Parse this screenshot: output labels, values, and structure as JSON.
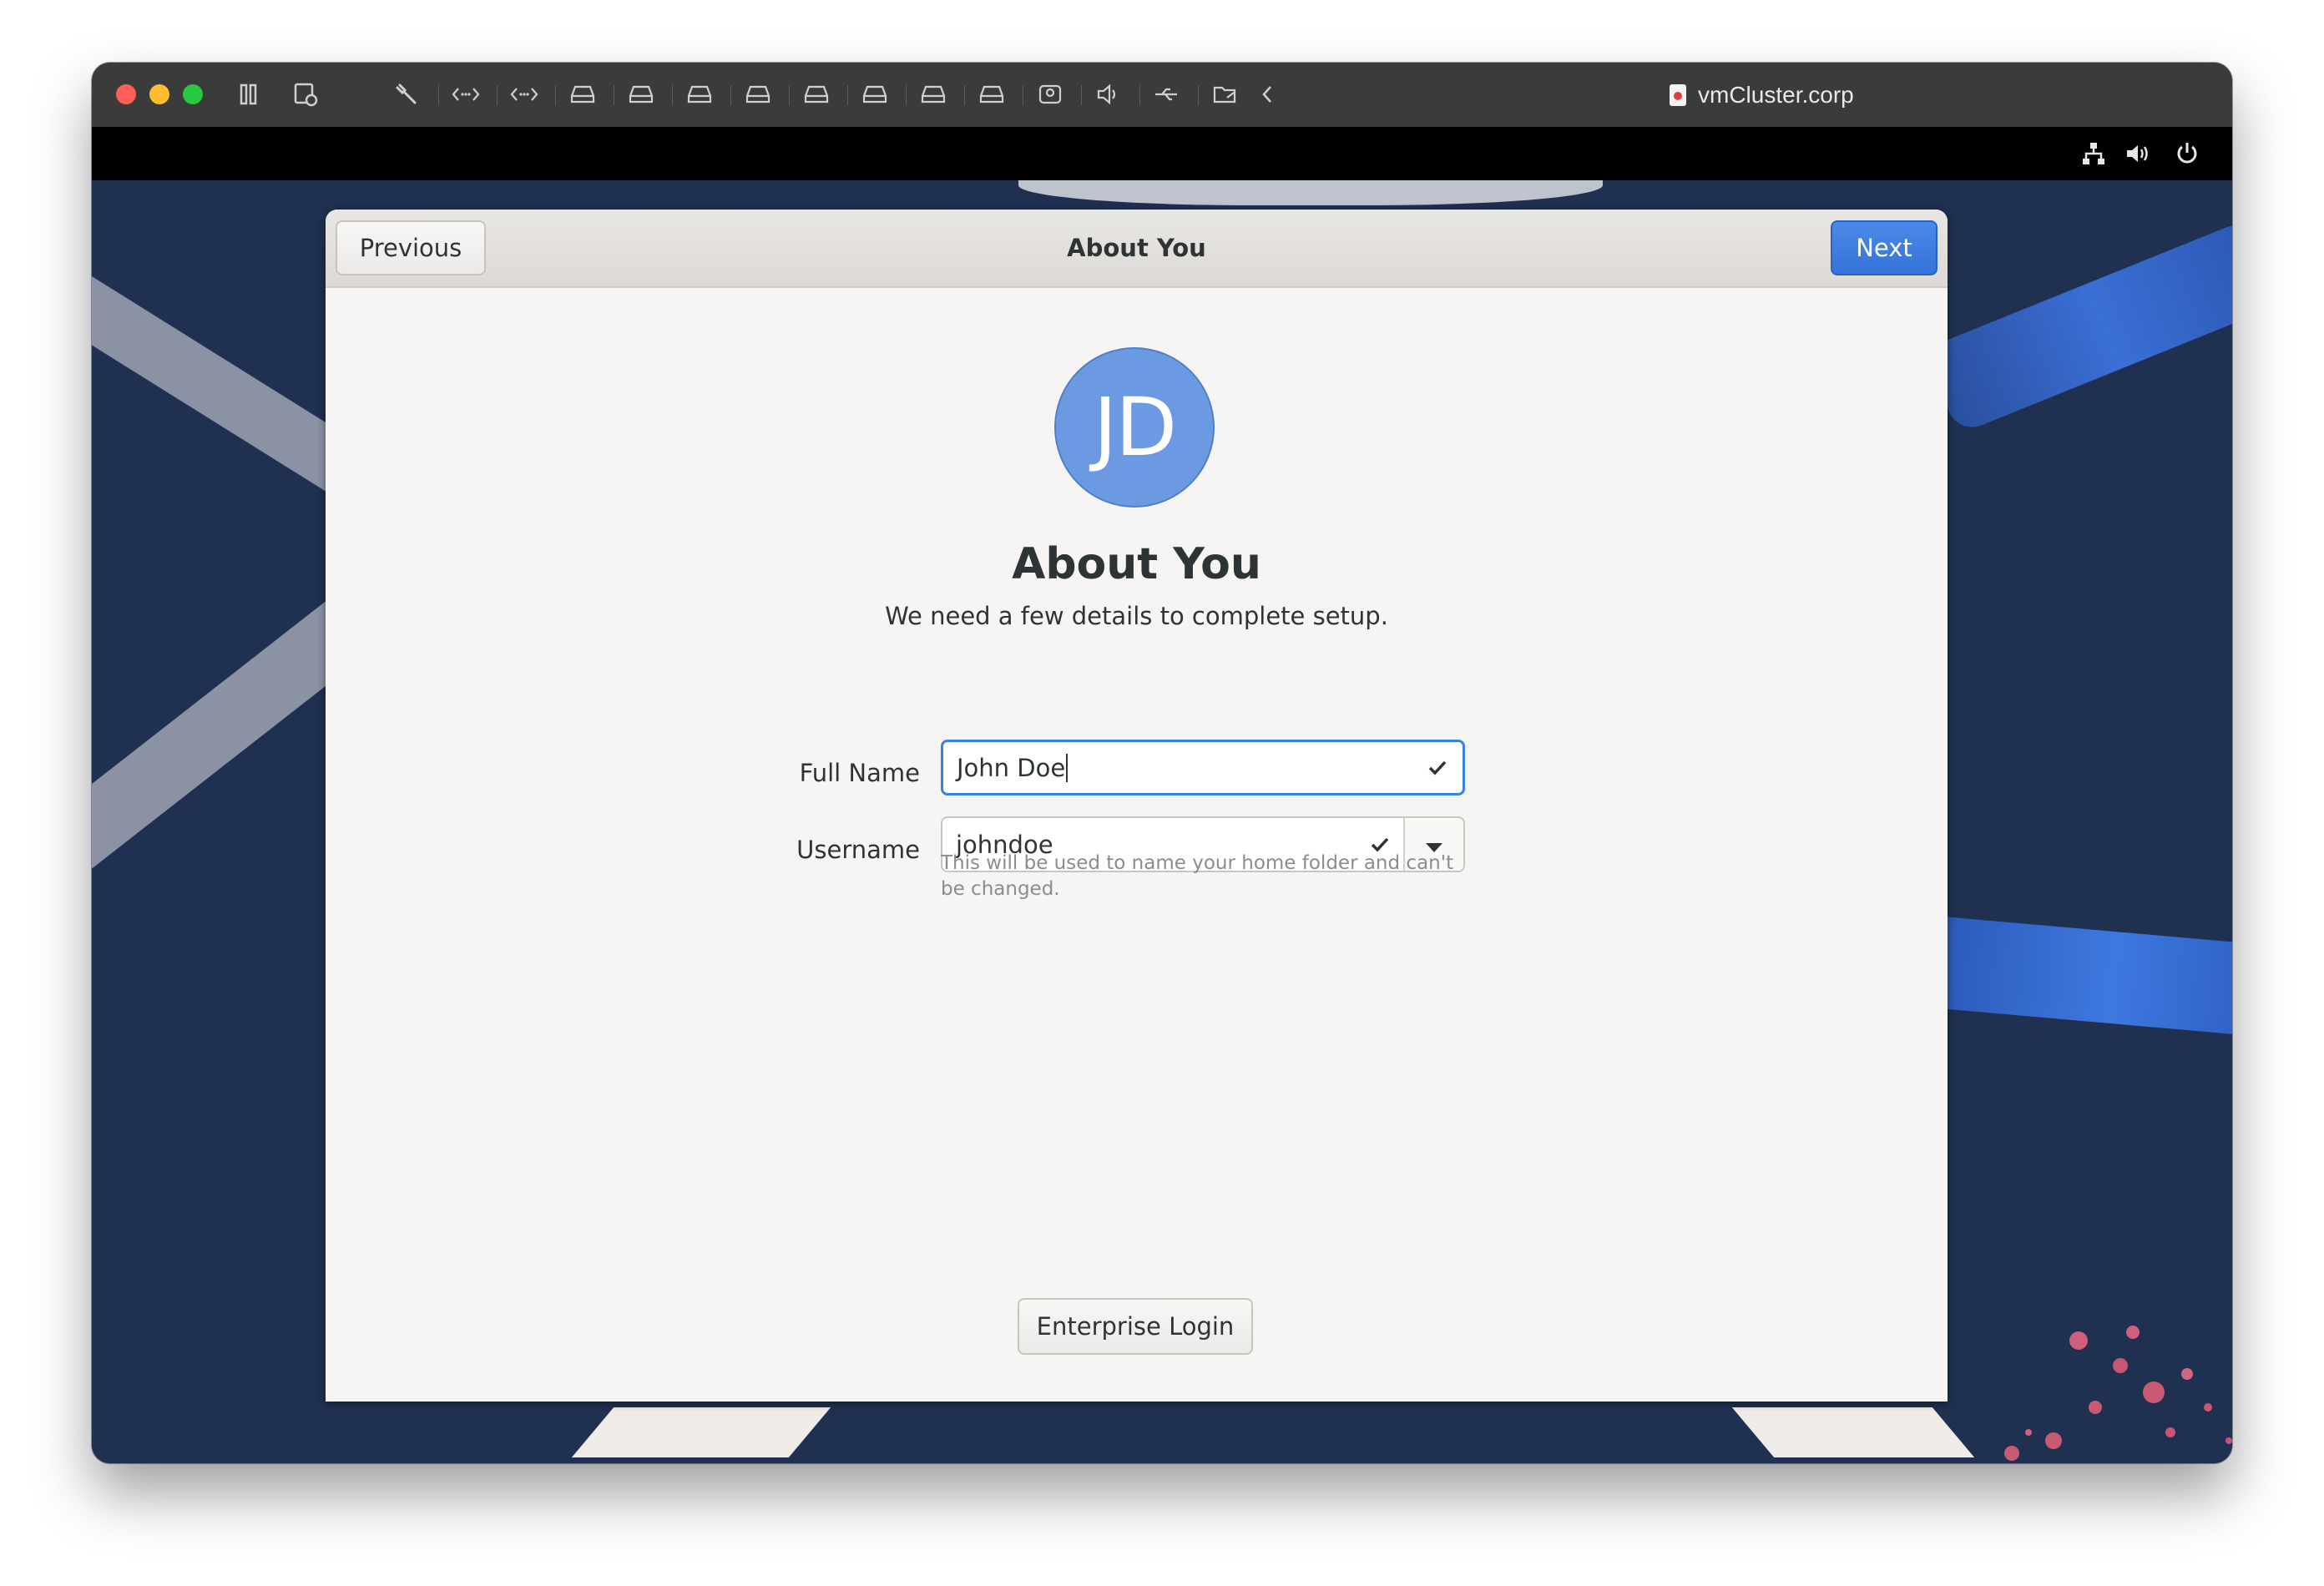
{
  "window": {
    "title": "vmCluster.corp"
  },
  "toolbar_icons": [
    "pause-icon",
    "snapshot-icon",
    "wrench-icon",
    "code-arrows-icon",
    "code-arrows-icon",
    "disk-icon",
    "disk-icon",
    "disk-icon",
    "disk-icon",
    "disk-icon",
    "disk-icon",
    "disk-icon",
    "disk-icon",
    "camera-icon",
    "speaker-icon",
    "usb-icon",
    "folder-share-icon",
    "chevron-left-icon"
  ],
  "guest_status_icons": [
    "network-icon",
    "volume-icon",
    "power-icon"
  ],
  "dialog": {
    "header": {
      "previous_label": "Previous",
      "title": "About You",
      "next_label": "Next"
    },
    "avatar_initials": "JD",
    "title": "About You",
    "subtitle": "We need a few details to complete setup.",
    "full_name": {
      "label": "Full Name",
      "value": "John Doe"
    },
    "username": {
      "label": "Username",
      "value": "johndoe",
      "hint": "This will be used to name your home folder and can't be changed."
    },
    "enterprise_login_label": "Enterprise Login"
  },
  "colors": {
    "accent": "#3584e4",
    "avatar": "#6b9ae3",
    "wallpaper": "#1f3050"
  }
}
